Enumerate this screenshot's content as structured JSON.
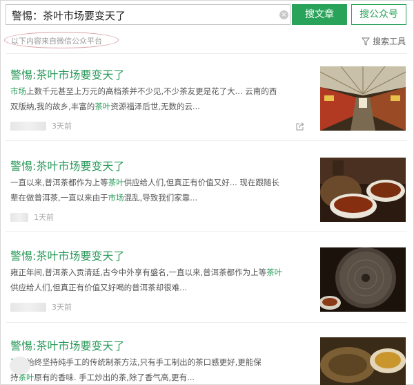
{
  "search": {
    "query": "警惕：茶叶市场要变天了",
    "clear_label": "×",
    "btn_article": "搜文章",
    "btn_account": "搜公众号"
  },
  "subbar": {
    "notice": "以下内容来自微信公众平台",
    "tools_label": "搜索工具"
  },
  "colors": {
    "accent": "#2aa35a",
    "title": "#2a9a5a"
  },
  "results": [
    {
      "title": "警惕:茶叶市场要变天了",
      "line1": [
        {
          "t": "市场",
          "h": true
        },
        {
          "t": "上数千元甚至上万元的高档茶并不少见,不少茶友更是花了大... 云南的西",
          "h": false
        }
      ],
      "line2": [
        {
          "t": "双版纳,我的故乡,丰富的",
          "h": false
        },
        {
          "t": "茶叶",
          "h": true
        },
        {
          "t": "资源福泽后世,无数的云...",
          "h": false
        }
      ],
      "time": "3天前",
      "thumb": "tea-market-street-photo"
    },
    {
      "title": "警惕:茶叶市场要变天了",
      "line1": [
        {
          "t": "一直以来,普洱茶都作为上等",
          "h": false
        },
        {
          "t": "茶叶",
          "h": true
        },
        {
          "t": "供应给人们,但真正有价值又好... 现在跟随长",
          "h": false
        }
      ],
      "line2": [
        {
          "t": "辈在做普洱茶,一直以来由于",
          "h": false
        },
        {
          "t": "市场",
          "h": true
        },
        {
          "t": "混乱,导致我们家靠...",
          "h": false
        }
      ],
      "time": "1天前",
      "thumb": "tea-cups-photo"
    },
    {
      "title": "警惕:茶叶市场要变天了",
      "line1": [
        {
          "t": "雍正年间,普洱茶入贡清廷,古今中外享有盛名,一直以来,普洱茶都作为上等",
          "h": false
        },
        {
          "t": "茶叶",
          "h": true
        }
      ],
      "line2": [
        {
          "t": "供应给人们,但真正有价值又好喝的普洱茶却很难...",
          "h": false
        }
      ],
      "time": "3天前",
      "thumb": "puer-tea-cake-photo"
    },
    {
      "title": "警惕:茶叶市场要变天了",
      "line1": [
        {
          "t": "茶叶",
          "h": true
        },
        {
          "t": "始终坚持纯手工的传统制茶方法,只有手工制出的茶口感更好,更能保",
          "h": false
        }
      ],
      "line2": [
        {
          "t": "持",
          "h": false
        },
        {
          "t": "茶叶",
          "h": true
        },
        {
          "t": "原有的香味. 手工炒出的茶,除了香气高,更有...",
          "h": false
        }
      ],
      "time": "",
      "thumb": "tea-leaves-photo"
    }
  ]
}
